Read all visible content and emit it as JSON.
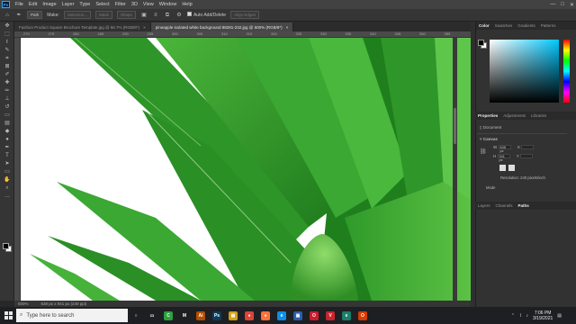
{
  "menubar": {
    "logo": "Ps",
    "items": [
      "File",
      "Edit",
      "Image",
      "Layer",
      "Type",
      "Select",
      "Filter",
      "3D",
      "View",
      "Window",
      "Help"
    ],
    "controls": [
      "—",
      "□",
      "✕"
    ]
  },
  "options": {
    "mode": "Path",
    "make_label": "Make:",
    "make_buttons": [
      "Selection...",
      "Mask",
      "Shape"
    ],
    "auto_add_delete": "Auto Add/Delete",
    "align_edges": "Align Edges"
  },
  "tabs": [
    {
      "label": "Fashion Product Square Brochure Template.jpg @ 66.7% (RGB/8*)",
      "close": "×"
    },
    {
      "label": "pineapple isolated white background 88281-232.jpg @ 500% (RGB/8*)",
      "close": "×"
    }
  ],
  "ruler": {
    "top_labels": [
      "270",
      "275",
      "280",
      "285",
      "290",
      "295",
      "300",
      "305",
      "310",
      "315",
      "320",
      "325",
      "330",
      "335",
      "340",
      "345",
      "350",
      "355"
    ]
  },
  "status": {
    "zoom": "500%",
    "dimensions": "638 px x 941 px (240 ppi)"
  },
  "panels": {
    "color_tabs": [
      "Color",
      "Swatches",
      "Gradients",
      "Patterns"
    ],
    "properties_tabs": [
      "Properties",
      "Adjustments",
      "Libraries"
    ],
    "document_label": "Document",
    "canvas_section": "Canvas",
    "w_label": "W",
    "w_value": "638 px",
    "h_label": "H",
    "h_value": "941 px",
    "x_label": "X",
    "y_label": "Y",
    "resolution": "Resolution: 240 pixels/inch",
    "mode_label": "Mode",
    "layers_tabs": [
      "Layers",
      "Channels",
      "Paths"
    ]
  },
  "taskbar": {
    "search_placeholder": "Type here to search",
    "apps": [
      {
        "name": "Cortana",
        "glyph": "○",
        "color": "#1d1f22"
      },
      {
        "name": "Task View",
        "glyph": "▭",
        "color": "#1d1f22"
      },
      {
        "name": "Camtasia",
        "glyph": "C",
        "color": "#2e9e3e"
      },
      {
        "name": "Movavi",
        "glyph": "M",
        "color": "#1e1e1e"
      },
      {
        "name": "Adobe Illustrator",
        "glyph": "Ai",
        "color": "#b34e00"
      },
      {
        "name": "Adobe Photoshop",
        "glyph": "Ps",
        "color": "#0b3c5d"
      },
      {
        "name": "File Explorer",
        "glyph": "▤",
        "color": "#d4a017"
      },
      {
        "name": "Google Chrome",
        "glyph": "●",
        "color": "#db4437"
      },
      {
        "name": "Firefox",
        "glyph": "●",
        "color": "#ff7139"
      },
      {
        "name": "Edge",
        "glyph": "e",
        "color": "#0c8ee8"
      },
      {
        "name": "Photos",
        "glyph": "▣",
        "color": "#2a5fa8"
      },
      {
        "name": "Opera",
        "glyph": "O",
        "color": "#cc1b2a"
      },
      {
        "name": "Vivaldi",
        "glyph": "V",
        "color": "#c8252a"
      },
      {
        "name": "Edge Dev",
        "glyph": "e",
        "color": "#1a7f6b"
      },
      {
        "name": "Office",
        "glyph": "O",
        "color": "#d83b01"
      }
    ],
    "time": "7:06 PM",
    "date": "3/19/2021"
  }
}
